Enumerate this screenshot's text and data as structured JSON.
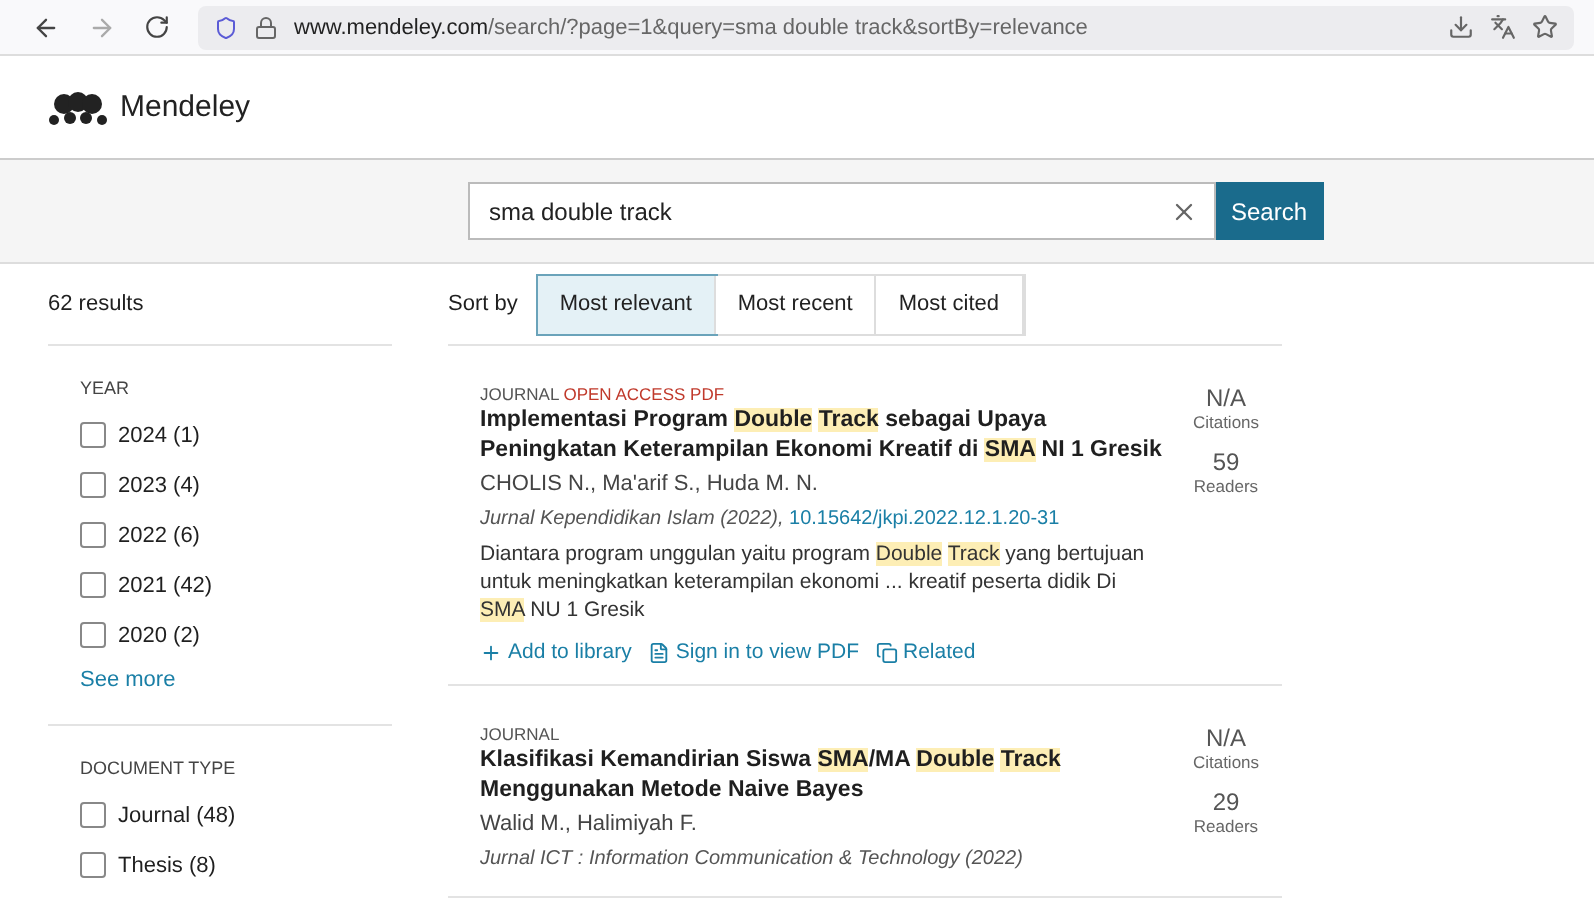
{
  "browser": {
    "url_host": "www.mendeley.com",
    "url_path": "/search/?page=1&query=sma double track&sortBy=relevance"
  },
  "header": {
    "logo": "Mendeley"
  },
  "search": {
    "value": "sma double track",
    "button": "Search"
  },
  "results_count": "62 results",
  "sort": {
    "label": "Sort by",
    "options": [
      {
        "label": "Most relevant",
        "selected": true
      },
      {
        "label": "Most recent",
        "selected": false
      },
      {
        "label": "Most cited",
        "selected": false
      }
    ]
  },
  "filters": [
    {
      "title": "YEAR",
      "options": [
        {
          "label": "2024 (1)",
          "checked": false
        },
        {
          "label": "2023 (4)",
          "checked": false
        },
        {
          "label": "2022 (6)",
          "checked": false
        },
        {
          "label": "2021 (42)",
          "checked": false
        },
        {
          "label": "2020 (2)",
          "checked": false
        }
      ],
      "more": "See more"
    },
    {
      "title": "DOCUMENT TYPE",
      "options": [
        {
          "label": "Journal (48)",
          "checked": false
        },
        {
          "label": "Thesis (8)",
          "checked": false
        }
      ]
    }
  ],
  "results": [
    {
      "type": "JOURNAL",
      "badge": "OPEN ACCESS PDF",
      "title": [
        {
          "text": "Implementasi Program ",
          "highlight": false
        },
        {
          "text": "Double Track",
          "highlight": true
        },
        {
          "text": " sebagai Upaya Peningkatan Keterampilan Ekonomi Kreatif di ",
          "highlight": false
        },
        {
          "text": "SMA",
          "highlight": true
        },
        {
          "text": " NI 1 Gresik",
          "highlight": false
        }
      ],
      "authors": "CHOLIS N., Ma'arif S., Huda M. N.",
      "source": "Jurnal Kependidikan Islam (2022), ",
      "doi": "10.15642/jkpi.2022.12.1.20-31",
      "abstract": [
        {
          "text": "Diantara program unggulan yaitu program ",
          "highlight": false
        },
        {
          "text": "Double Track",
          "highlight": true
        },
        {
          "text": " yang bertujuan untuk meningkatkan keterampilan ekonomi ... kreatif peserta didik Di ",
          "highlight": false
        },
        {
          "text": "SMA",
          "highlight": true
        },
        {
          "text": " NU 1 Gresik",
          "highlight": false
        }
      ],
      "citations": "N/A",
      "citations_label": "Citations",
      "readers": "59",
      "readers_label": "Readers",
      "actions": [
        "Add to library",
        "Sign in to view PDF",
        "Related"
      ]
    },
    {
      "type": "JOURNAL",
      "title": [
        {
          "text": "Klasifikasi Kemandirian Siswa ",
          "highlight": false
        },
        {
          "text": "SMA",
          "highlight": true
        },
        {
          "text": "/MA ",
          "highlight": false
        },
        {
          "text": "Double Track",
          "highlight": true
        },
        {
          "text": " Menggunakan Metode Naive Bayes",
          "highlight": false
        }
      ],
      "authors": "Walid M., Halimiyah F.",
      "source": "Jurnal ICT : Information Communication & Technology (2022)",
      "citations": "N/A",
      "citations_label": "Citations",
      "readers": "29",
      "readers_label": "Readers"
    }
  ]
}
